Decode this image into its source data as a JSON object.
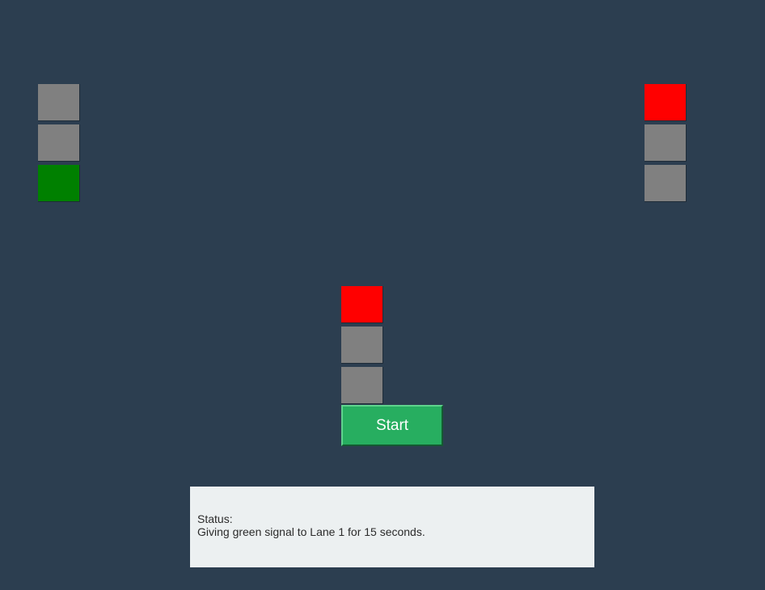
{
  "colors": {
    "background": "#2c3e50",
    "lamp_off": "#808080",
    "lamp_red": "#ff0000",
    "lamp_green": "#008000",
    "button": "#27ae60",
    "status_bg": "#ecf0f1"
  },
  "signals": [
    {
      "id": "left",
      "lamps": [
        "off",
        "off",
        "green"
      ]
    },
    {
      "id": "right",
      "lamps": [
        "red",
        "off",
        "off"
      ]
    },
    {
      "id": "center",
      "lamps": [
        "red",
        "off",
        "off"
      ]
    }
  ],
  "controls": {
    "start_label": "Start"
  },
  "status": {
    "heading": "Status:",
    "message": "Giving green signal to Lane 1 for 15 seconds."
  }
}
